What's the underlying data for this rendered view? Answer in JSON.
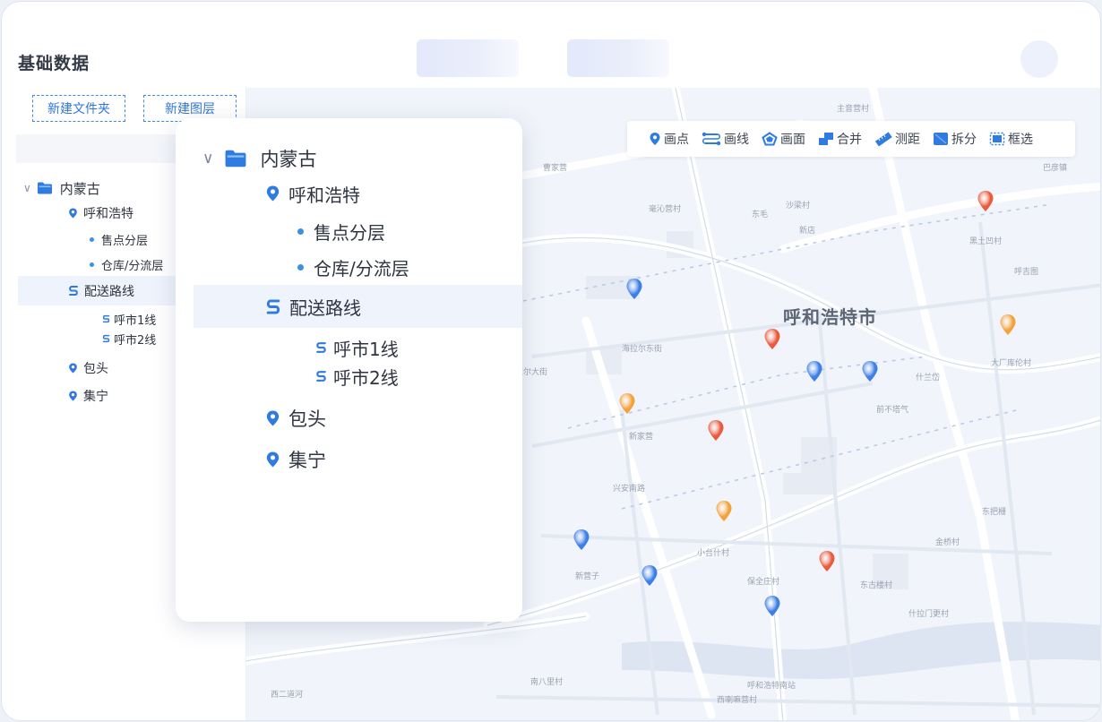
{
  "header": {
    "title": "基础数据"
  },
  "sidebar": {
    "new_folder_label": "新建文件夹",
    "new_layer_label": "新建图层",
    "tree": {
      "root": "内蒙古",
      "city1": "呼和浩特",
      "layer1": "售点分层",
      "layer2": "仓库/分流层",
      "route_group": "配送路线",
      "route1": "呼市1线",
      "route2": "呼市2线",
      "city2": "包头",
      "city3": "集宁"
    }
  },
  "toolbar": {
    "draw_point": "画点",
    "draw_line": "画线",
    "draw_polygon": "画面",
    "merge": "合并",
    "measure": "测距",
    "split": "拆分",
    "box_select": "框选"
  },
  "map": {
    "city_label": "呼和浩特市",
    "place_labels": [
      "主音营村",
      "巴彦镇",
      "曹家营",
      "毫沁营村",
      "东毛",
      "沙梁村",
      "新店",
      "黑土凹村",
      "呼吉图",
      "海拉尔东街",
      "海拉尔大街",
      "大厂库伦村",
      "什兰岱",
      "前不塔气",
      "新家营",
      "兴安南路",
      "小台什村",
      "东把栅",
      "新营子",
      "保全庄村",
      "东古楼村",
      "金桥村",
      "南八里村",
      "西二道河",
      "什拉门更村",
      "西喇嘛营村",
      "呼和浩特南站"
    ],
    "marker_colors": {
      "blue": "#3d7fe6",
      "red": "#ea5a3c",
      "orange": "#f3a23a"
    },
    "route_color": "#b8c8e6"
  },
  "colors": {
    "accent": "#3b8fe8",
    "selection_bg": "#eef3fc"
  }
}
